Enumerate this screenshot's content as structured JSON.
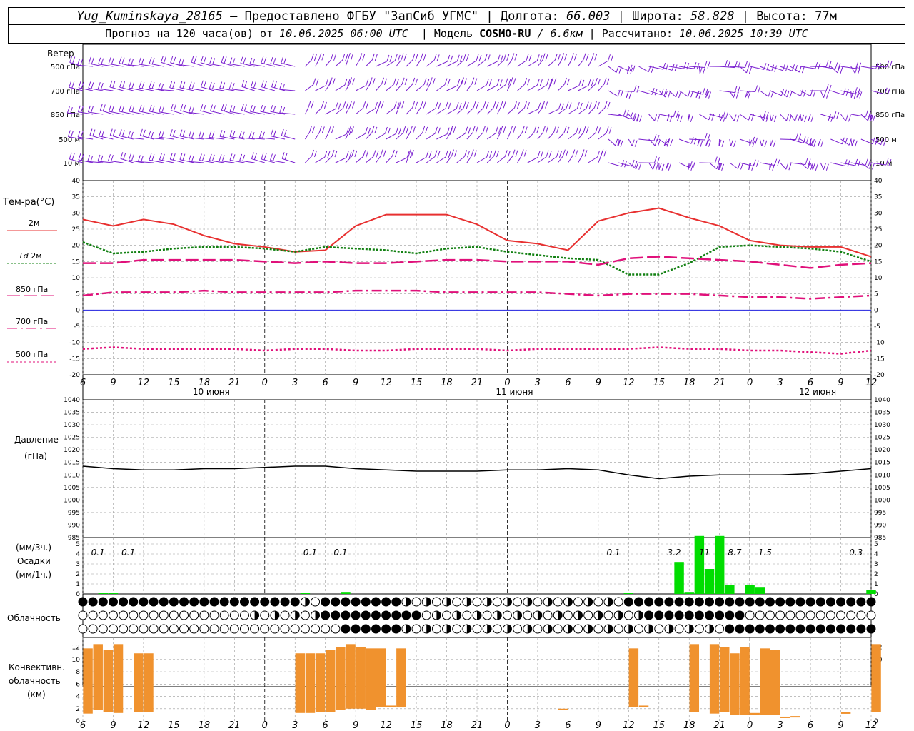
{
  "header": {
    "station": "Yug_Kuminskaya_28165",
    "provider": "– Предоставлено ФГБУ \"ЗапСиб УГМС\"",
    "lon_label": "Долгота:",
    "lon": "66.003",
    "lat_label": "Широта:",
    "lat": "58.828",
    "alt_label": "Высота:",
    "alt": "77м",
    "forecast_prefix": "Прогноз на 120 часа(ов) от",
    "forecast_time": "10.06.2025 06:00 UTC",
    "model_label": "Модель",
    "model": "COSMO-RU",
    "model_res": "/ 6.6км",
    "calc_label": "Рассчитано:",
    "calc_time": "10.06.2025 10:39 UTC"
  },
  "labels": {
    "wind": "Ветер",
    "wind_levels": [
      "500 гПа",
      "700 гПа",
      "850 гПа",
      "500 м",
      "10 м"
    ],
    "temp": "Тем-ра(°С)",
    "t2m": "2м",
    "td": "Td",
    "td2m": "2м",
    "t850": "850 гПа",
    "t700": "700 гПа",
    "t500": "500 гПа",
    "pressure": "Давление",
    "pressure_unit": "(гПа)",
    "precip_3h": "(мм/3ч.)",
    "precip": "Осадки",
    "precip_1h": "(мм/1ч.)",
    "cloud": "Облачность",
    "conv1": "Конвективн.",
    "conv2": "облачность",
    "conv3": "(км)",
    "days": [
      "10 июня",
      "11 июня",
      "12 июня"
    ],
    "hour_ticks": [
      "6",
      "9",
      "12",
      "15",
      "18",
      "21",
      "0",
      "3",
      "6",
      "9",
      "12",
      "15",
      "18",
      "21",
      "0",
      "3",
      "6",
      "9",
      "12",
      "15",
      "18",
      "21",
      "0",
      "3",
      "6",
      "9",
      "12"
    ]
  },
  "colors": {
    "wind": "#7a1fd0",
    "t2m": "#e83030",
    "td": "#128012",
    "levels": "#e0107a",
    "precip": "#00dd00",
    "conv": "#f0922e",
    "zero": "#2020e0"
  },
  "chart_data": [
    {
      "type": "line",
      "title": "Тем-ра(°С)",
      "ylim": [
        -20,
        40
      ],
      "x_hours_from_start": [
        0,
        3,
        6,
        9,
        12,
        15,
        18,
        21,
        24,
        27,
        30,
        33,
        36,
        39,
        42,
        45,
        48,
        51,
        54,
        57,
        60,
        63,
        66,
        69,
        72,
        75,
        78
      ],
      "series": [
        {
          "name": "2м",
          "values": [
            28,
            26,
            28,
            26.5,
            23,
            20.5,
            19.5,
            18,
            18.5,
            26,
            29.5,
            29.5,
            29.5,
            26.5,
            21.5,
            20.5,
            18.5,
            27.5,
            30,
            31.5,
            28.5,
            26,
            21.5,
            20,
            19.5,
            19.5,
            16.5
          ]
        },
        {
          "name": "Td 2м",
          "values": [
            21,
            17.5,
            18,
            19,
            19.5,
            19.5,
            19,
            18,
            19.5,
            19,
            18.5,
            17.5,
            19,
            19.5,
            18,
            17,
            16,
            15.5,
            11,
            11,
            14.5,
            19.5,
            20,
            19.5,
            19,
            18,
            15
          ]
        },
        {
          "name": "850 гПа",
          "values": [
            14.5,
            14.5,
            15.5,
            15.5,
            15.5,
            15.5,
            15,
            14.5,
            15,
            14.5,
            14.5,
            15,
            15.5,
            15.5,
            15,
            15,
            15,
            14,
            16,
            16.5,
            16,
            15.5,
            15,
            14,
            13,
            14,
            14.5
          ]
        },
        {
          "name": "700 гПа",
          "values": [
            4.5,
            5.5,
            5.5,
            5.5,
            6,
            5.5,
            5.5,
            5.5,
            5.5,
            6,
            6,
            6,
            5.5,
            5.5,
            5.5,
            5.5,
            5,
            4.5,
            5,
            5,
            5,
            4.5,
            4,
            4,
            3.5,
            4,
            4.5
          ]
        },
        {
          "name": "500 гПа",
          "values": [
            -12,
            -11.5,
            -12,
            -12,
            -12,
            -12,
            -12.5,
            -12,
            -12,
            -12.5,
            -12.5,
            -12,
            -12,
            -12,
            -12.5,
            -12,
            -12,
            -12,
            -12,
            -11.5,
            -12,
            -12,
            -12.5,
            -12.5,
            -13,
            -13.5,
            -12.5
          ]
        }
      ]
    },
    {
      "type": "line",
      "title": "Давление",
      "ylabel": "(гПа)",
      "ylim": [
        985,
        1040
      ],
      "x_hours_from_start": [
        0,
        3,
        6,
        9,
        12,
        15,
        18,
        21,
        24,
        27,
        30,
        33,
        36,
        39,
        42,
        45,
        48,
        51,
        54,
        57,
        60,
        63,
        66,
        69,
        72,
        75,
        78
      ],
      "series": [
        {
          "name": "Давление",
          "values": [
            1013.5,
            1012.5,
            1012,
            1012,
            1012.5,
            1012.5,
            1013,
            1013.5,
            1013.5,
            1012.5,
            1012,
            1011.5,
            1011.5,
            1011.5,
            1012,
            1012,
            1012.5,
            1012,
            1010,
            1008.5,
            1009.5,
            1010,
            1010,
            1010,
            1010.5,
            1011.5,
            1012.5
          ]
        }
      ]
    },
    {
      "type": "bar",
      "title": "Осадки",
      "ylim": [
        0,
        5
      ],
      "labels_3h": [
        {
          "h": 1.5,
          "text": "0.1"
        },
        {
          "h": 4.5,
          "text": "0.1"
        },
        {
          "h": 22.5,
          "text": "0.1"
        },
        {
          "h": 25.5,
          "text": "0.1"
        },
        {
          "h": 52.5,
          "text": "0.1"
        },
        {
          "h": 58.5,
          "text": "3.2"
        },
        {
          "h": 61.5,
          "text": "11"
        },
        {
          "h": 64.5,
          "text": "8.7"
        },
        {
          "h": 67.5,
          "text": "1.5"
        },
        {
          "h": 76.5,
          "text": "0.3"
        }
      ],
      "bars_mm_per_h": [
        {
          "h": 2,
          "v": 0.1
        },
        {
          "h": 3,
          "v": 0.1
        },
        {
          "h": 22,
          "v": 0.1
        },
        {
          "h": 26,
          "v": 0.2
        },
        {
          "h": 54,
          "v": 0.1
        },
        {
          "h": 59,
          "v": 3.2
        },
        {
          "h": 60,
          "v": 0.2
        },
        {
          "h": 61,
          "v": 6
        },
        {
          "h": 62,
          "v": 2.5
        },
        {
          "h": 63,
          "v": 6
        },
        {
          "h": 64,
          "v": 0.9
        },
        {
          "h": 66,
          "v": 0.9
        },
        {
          "h": 67,
          "v": 0.7
        },
        {
          "h": 78,
          "v": 0.4
        }
      ]
    },
    {
      "type": "bar",
      "title": "Конвективн. облачность (км)",
      "ylim": [
        0,
        13
      ],
      "bars_km": [
        {
          "h": 0.5,
          "base": 1.2,
          "top": 11.8
        },
        {
          "h": 1.5,
          "base": 1.8,
          "top": 12.5
        },
        {
          "h": 2.5,
          "base": 1.5,
          "top": 11.5
        },
        {
          "h": 3.5,
          "base": 1.3,
          "top": 12.5
        },
        {
          "h": 5.5,
          "base": 1.5,
          "top": 11
        },
        {
          "h": 6.5,
          "base": 1.5,
          "top": 11
        },
        {
          "h": 21.5,
          "base": 1.3,
          "top": 11
        },
        {
          "h": 22.5,
          "base": 1.3,
          "top": 11
        },
        {
          "h": 23.5,
          "base": 1.5,
          "top": 11
        },
        {
          "h": 24.5,
          "base": 1.5,
          "top": 11.5
        },
        {
          "h": 25.5,
          "base": 1.8,
          "top": 12
        },
        {
          "h": 26.5,
          "base": 2,
          "top": 12.5
        },
        {
          "h": 27.5,
          "base": 2,
          "top": 12
        },
        {
          "h": 28.5,
          "base": 1.8,
          "top": 11.8
        },
        {
          "h": 29.5,
          "base": 2.3,
          "top": 11.8
        },
        {
          "h": 30.5,
          "base": 2.3,
          "top": 2.5
        },
        {
          "h": 31.5,
          "base": 2.2,
          "top": 11.8
        },
        {
          "h": 47.5,
          "base": 1.8,
          "top": 2
        },
        {
          "h": 54.5,
          "base": 2.3,
          "top": 11.8
        },
        {
          "h": 55.5,
          "base": 2.3,
          "top": 2.5
        },
        {
          "h": 60.5,
          "base": 1.5,
          "top": 12.5
        },
        {
          "h": 62.5,
          "base": 1.2,
          "top": 12.5
        },
        {
          "h": 63.5,
          "base": 1.5,
          "top": 12
        },
        {
          "h": 64.5,
          "base": 1,
          "top": 11
        },
        {
          "h": 65.5,
          "base": 1,
          "top": 12
        },
        {
          "h": 66.5,
          "base": 1,
          "top": 1.3
        },
        {
          "h": 67.5,
          "base": 1,
          "top": 11.8
        },
        {
          "h": 68.5,
          "base": 1,
          "top": 11.5
        },
        {
          "h": 69.5,
          "base": 0.5,
          "top": 0.7
        },
        {
          "h": 70.5,
          "base": 0.6,
          "top": 0.8
        },
        {
          "h": 75.5,
          "base": 1.2,
          "top": 1.4
        },
        {
          "h": 78.5,
          "base": 1.5,
          "top": 12.5
        }
      ]
    }
  ]
}
